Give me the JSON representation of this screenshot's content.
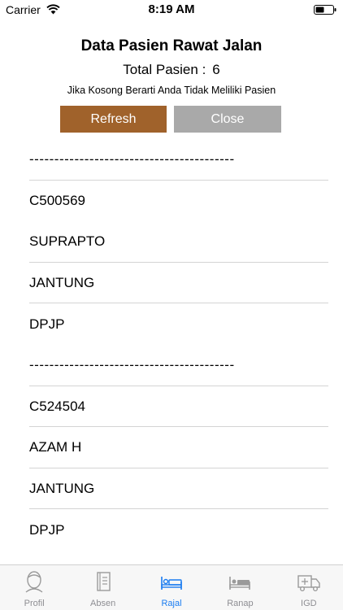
{
  "status_bar": {
    "carrier": "Carrier",
    "time": "8:19 AM"
  },
  "header": {
    "title": "Data Pasien Rawat Jalan",
    "total_label": "Total Pasien :",
    "total_value": "6",
    "note": "Jika Kosong Berarti Anda Tidak Meliliki Pasien"
  },
  "buttons": {
    "refresh_label": "Refresh",
    "close_label": "Close"
  },
  "list": {
    "rows": [
      "-----------------------------------------",
      "C500569",
      "SUPRAPTO",
      "JANTUNG",
      "DPJP",
      "-----------------------------------------",
      "C524504",
      "AZAM H",
      "JANTUNG",
      "DPJP"
    ]
  },
  "tabs": [
    {
      "label": "Profil",
      "icon": "profile-icon"
    },
    {
      "label": "Absen",
      "icon": "notebook-icon"
    },
    {
      "label": "Rajal",
      "icon": "bed-icon"
    },
    {
      "label": "Ranap",
      "icon": "bed-icon"
    },
    {
      "label": "IGD",
      "icon": "truck-icon"
    }
  ],
  "colors": {
    "accent": "#1a7cf0",
    "refresh": "#a0622b",
    "close": "#a9a9a9"
  }
}
